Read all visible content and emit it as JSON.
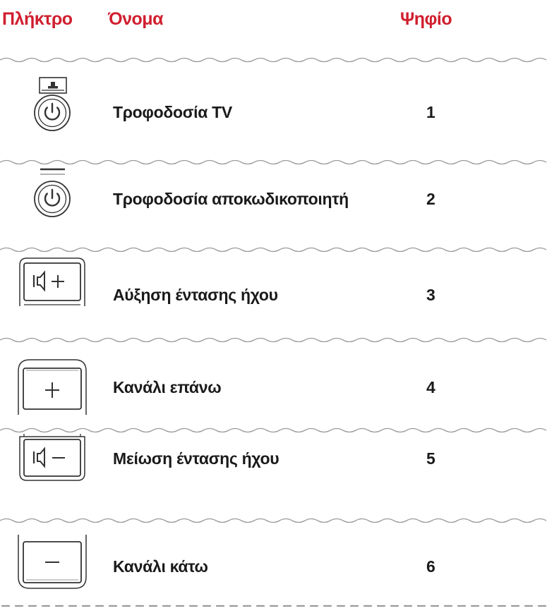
{
  "header": {
    "key": "Πλήκτρο",
    "name": "Όνομα",
    "digit": "Ψηφίο"
  },
  "rows": [
    {
      "icon": "tv-power-button-icon",
      "name": "Τροφοδοσία TV",
      "digit": "1"
    },
    {
      "icon": "decoder-power-button-icon",
      "name": "Τροφοδοσία αποκωδικοποιητή",
      "digit": "2"
    },
    {
      "icon": "volume-up-button-icon",
      "name": "Αύξηση έντασης ήχου",
      "digit": "3"
    },
    {
      "icon": "channel-up-button-icon",
      "name": "Κανάλι επάνω",
      "digit": "4"
    },
    {
      "icon": "volume-down-button-icon",
      "name": "Μείωση έντασης ήχου",
      "digit": "5"
    },
    {
      "icon": "channel-down-button-icon",
      "name": "Κανάλι κάτω",
      "digit": "6"
    }
  ],
  "colors": {
    "header_text": "#d01f2f",
    "body_text": "#1a1a1a",
    "line": "#9a9a9a"
  }
}
